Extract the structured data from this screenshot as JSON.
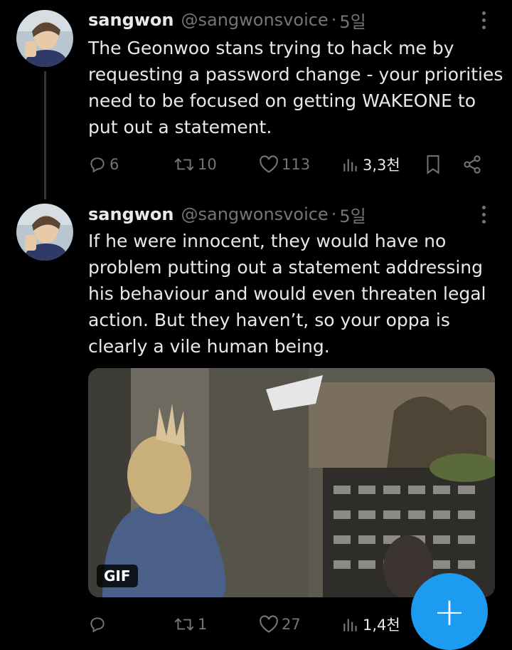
{
  "tweets": [
    {
      "name": "sangwon",
      "handle": "@sangwonsvoice",
      "separator": "·",
      "time": "5일",
      "text": "The Geonwoo stans trying to hack me by requesting a password change - your priorities need to be focused on getting WAKEONE to put out a statement.",
      "replies": "6",
      "retweets": "10",
      "likes": "113",
      "views": "3,3천"
    },
    {
      "name": "sangwon",
      "handle": "@sangwonsvoice",
      "separator": "·",
      "time": "5일",
      "text": "If he were innocent, they would have no problem putting out a statement addressing his behaviour and would even threaten legal action. But they haven’t, so your oppa is clearly a vile human being.",
      "media_badge": "GIF",
      "replies": "",
      "retweets": "1",
      "likes": "27",
      "views": "1,4천"
    }
  ],
  "fab": {
    "label": "+",
    "icon": "plus-icon"
  },
  "colors": {
    "background": "#000000",
    "text": "#e7e9ea",
    "muted": "#71767b",
    "accent": "#1d9bf0"
  }
}
